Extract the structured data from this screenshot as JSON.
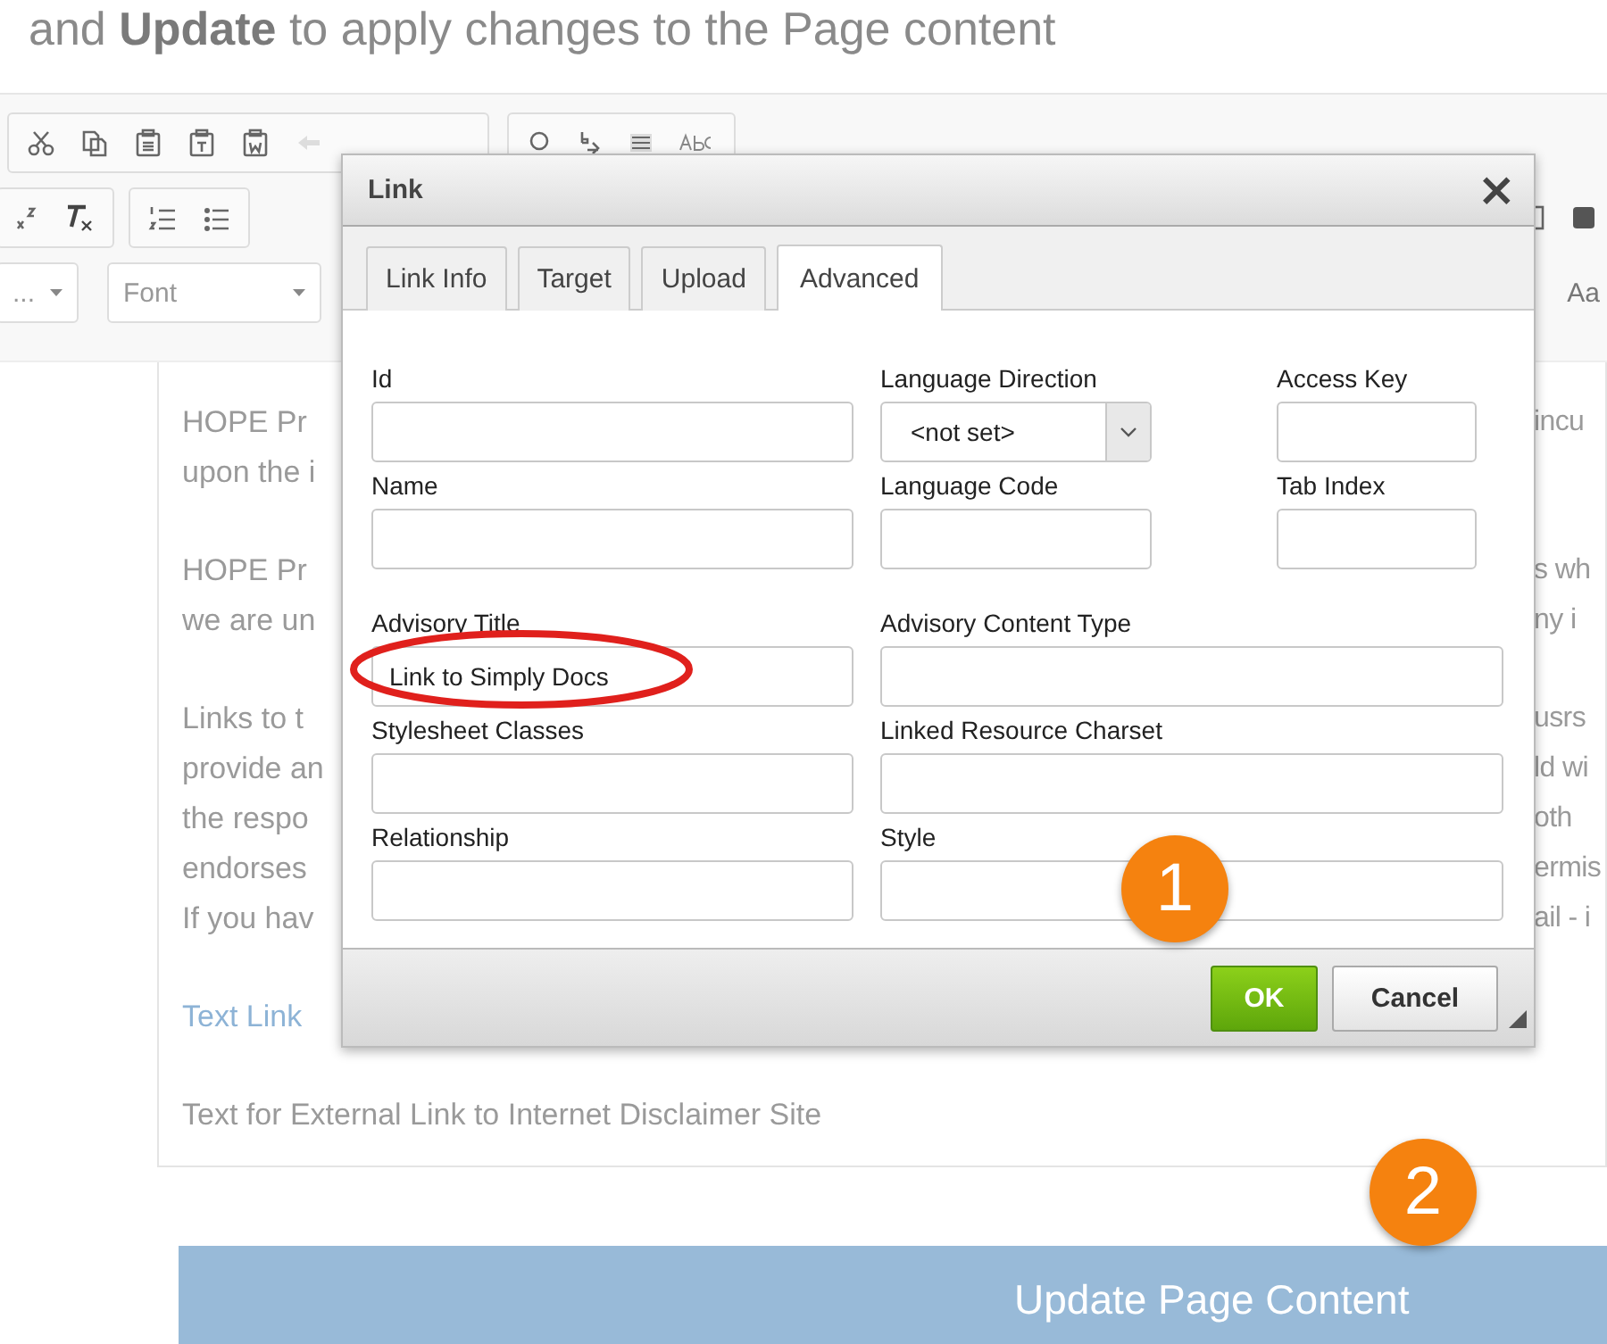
{
  "instruction": "and **Update** to apply changes to the Page content",
  "toolbar": {
    "dropdowns": [
      {
        "label": "..."
      },
      {
        "label": "Font"
      }
    ],
    "right_label": "Aa"
  },
  "editor": {
    "lines": [
      {
        "left": "HOPE Pr",
        "right": "incu",
        "kind": "text"
      },
      {
        "left": "upon the i",
        "kind": "text"
      },
      {
        "kind": "gap"
      },
      {
        "left": "HOPE Pr",
        "right": "s wh",
        "kind": "text"
      },
      {
        "left": "we are un",
        "right": "ny i",
        "kind": "text"
      },
      {
        "kind": "gap"
      },
      {
        "left": "Links to t",
        "right": "usrs",
        "kind": "text"
      },
      {
        "left": "provide an",
        "right": "ld wi",
        "kind": "text"
      },
      {
        "left": "the respo",
        "right": "oth",
        "kind": "text"
      },
      {
        "left": "endorses",
        "right": "ermis",
        "kind": "text"
      },
      {
        "left": "If you hav",
        "right": "ail - i",
        "kind": "text"
      },
      {
        "kind": "gap"
      },
      {
        "left": "Text Link",
        "kind": "link"
      },
      {
        "kind": "gap"
      },
      {
        "left": "Text for External Link to Internet Disclaimer Site",
        "kind": "text"
      }
    ]
  },
  "dialog": {
    "title": "Link",
    "close": "×",
    "tabs": [
      {
        "label": "Link Info",
        "selected": false
      },
      {
        "label": "Target",
        "selected": false
      },
      {
        "label": "Upload",
        "selected": false
      },
      {
        "label": "Advanced",
        "selected": true
      }
    ],
    "rows": [
      [
        {
          "label": "Id",
          "kind": "text"
        },
        {
          "label": "Language Direction",
          "kind": "select",
          "value": "<not set>"
        },
        {
          "label": "Access Key",
          "kind": "text"
        }
      ],
      [
        {
          "label": "Name",
          "kind": "text"
        },
        {
          "label": "Language Code",
          "kind": "text"
        },
        {
          "label": "Tab Index",
          "kind": "text"
        }
      ],
      [
        {
          "label": "Advisory Title",
          "kind": "text",
          "value": "Link to Simply Docs"
        },
        {
          "label": "Advisory Content Type",
          "kind": "text"
        }
      ],
      [
        {
          "label": "Stylesheet Classes",
          "kind": "text"
        },
        {
          "label": "Linked Resource Charset",
          "kind": "text"
        }
      ],
      [
        {
          "label": "Relationship",
          "kind": "text"
        },
        {
          "label": "Style",
          "kind": "text"
        }
      ]
    ],
    "buttons": [
      {
        "label": "OK",
        "kind": "primary"
      },
      {
        "label": "Cancel",
        "kind": "secondary"
      }
    ]
  },
  "annotations": [
    {
      "label": "1"
    },
    {
      "label": "2"
    }
  ],
  "update_button": {
    "label": "Update Page Content"
  }
}
